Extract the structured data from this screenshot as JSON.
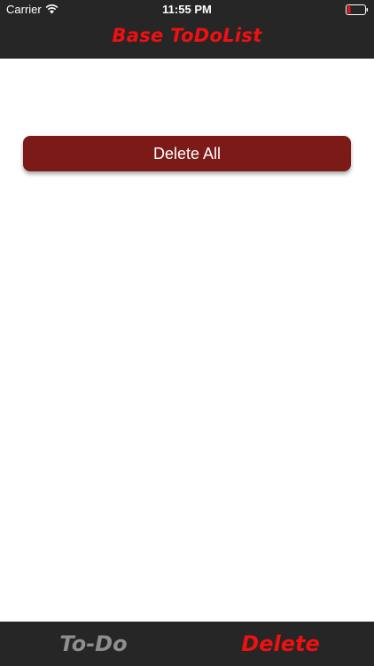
{
  "status_bar": {
    "carrier": "Carrier",
    "time": "11:55 PM",
    "wifi_icon": "wifi-icon",
    "battery_icon": "battery-low-icon"
  },
  "header": {
    "title": "Base ToDoList"
  },
  "main": {
    "delete_all_label": "Delete All"
  },
  "tabs": [
    {
      "label": "To-Do",
      "selected": false
    },
    {
      "label": "Delete",
      "selected": true
    }
  ],
  "colors": {
    "bar_background": "#262626",
    "accent_red": "#f01010",
    "button_background": "#7c1a17",
    "inactive_tab": "#8e8e8e"
  }
}
